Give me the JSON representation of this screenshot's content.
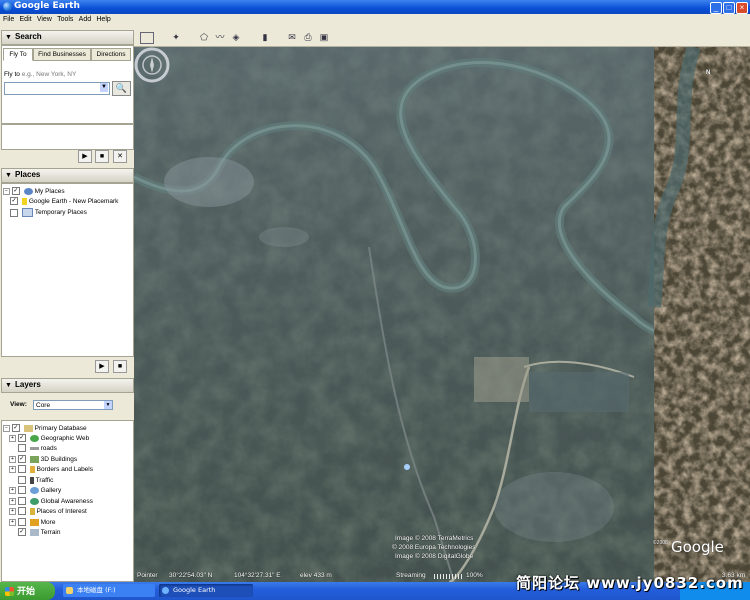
{
  "window": {
    "title": "Google Earth"
  },
  "menu": [
    "File",
    "Edit",
    "View",
    "Tools",
    "Add",
    "Help"
  ],
  "search": {
    "header": "Search",
    "tabs": [
      "Fly To",
      "Find Businesses",
      "Directions"
    ],
    "fly_label": "Fly to",
    "fly_placeholder": "e.g., New York, NY"
  },
  "places": {
    "header": "Places",
    "items": [
      "My Places",
      "Google Earth - New Placemark",
      "Temporary Places"
    ]
  },
  "layers": {
    "header": "Layers",
    "view_label": "View:",
    "view_value": "Core",
    "items": [
      "Primary Database",
      "Geographic Web",
      "roads",
      "3D Buildings",
      "Borders and Labels",
      "Traffic",
      "Gallery",
      "Global Awareness",
      "Places of Interest",
      "More",
      "Terrain"
    ]
  },
  "map": {
    "credits": [
      "Image © 2008 TerraMetrics",
      "© 2008 Europa Technologies",
      "Image © 2008 DigitalGlobe"
    ],
    "pointer_label": "Pointer",
    "lat": "30°22'54.03\" N",
    "lon": "104°32'27.31\" E",
    "elev": "elev  433 m",
    "streaming_label": "Streaming",
    "streaming_pct": "100%",
    "eye_alt": "3.63 km",
    "logo": "Google",
    "copyright_small": "©2008",
    "compass_letter": "N"
  },
  "taskbar": {
    "start": "开始",
    "items": [
      "本地磁盘 (F:)",
      "Google Earth"
    ]
  },
  "watermark": "简阳论坛  www.jy0832.com"
}
